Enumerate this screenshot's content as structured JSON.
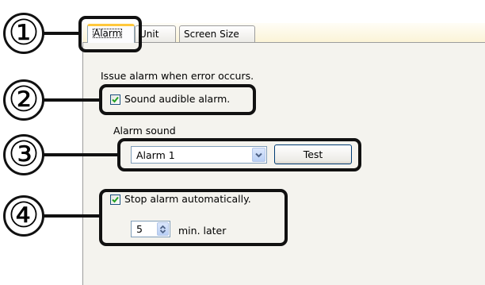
{
  "tabs": [
    {
      "label": "Alarm",
      "active": true
    },
    {
      "label": "Unit",
      "active": false
    },
    {
      "label": "Screen Size",
      "active": false
    }
  ],
  "alarm": {
    "intro_text": "Issue alarm when error occurs.",
    "sound_checkbox": {
      "label": "Sound audible alarm.",
      "checked": true
    },
    "alarm_sound_label": "Alarm sound",
    "alarm_sound_select": {
      "value": "Alarm 1"
    },
    "test_button_label": "Test",
    "stop_checkbox": {
      "label": "Stop alarm automatically.",
      "checked": true
    },
    "stop_minutes": {
      "value": "5",
      "suffix": "min. later"
    }
  },
  "callouts": [
    "①",
    "②",
    "③",
    "④"
  ],
  "icons": {
    "checkmark": "checkmark-icon",
    "dropdown": "chevron-down-icon",
    "spinner": "spin-arrows-icon"
  },
  "colors": {
    "check_green": "#21a121",
    "tab_highlight": "#ffc83c",
    "input_border": "#7f9db9",
    "callout": "#111111"
  }
}
